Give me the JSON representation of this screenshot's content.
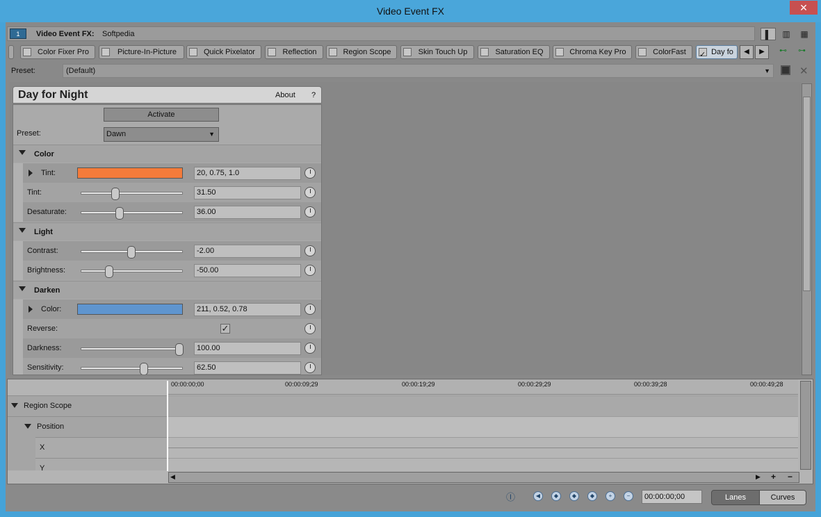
{
  "window": {
    "title": "Video Event FX",
    "close_glyph": "✕"
  },
  "fx_header": {
    "label": "Video Event FX:",
    "name": "Softpedia",
    "badge": "1"
  },
  "tabs": [
    {
      "label": "Color Fixer Pro"
    },
    {
      "label": "Picture-In-Picture"
    },
    {
      "label": "Quick Pixelator"
    },
    {
      "label": "Reflection"
    },
    {
      "label": "Region Scope"
    },
    {
      "label": "Skin Touch Up"
    },
    {
      "label": "Saturation EQ"
    },
    {
      "label": "Chroma Key Pro"
    },
    {
      "label": "ColorFast"
    },
    {
      "label": "Day fo"
    }
  ],
  "preset_bar": {
    "label": "Preset:",
    "value": "(Default)"
  },
  "plugin": {
    "title": "Day for Night",
    "about": "About",
    "help": "?",
    "activate": "Activate",
    "preset_label": "Preset:",
    "preset_value": "Dawn",
    "sections": {
      "color": {
        "title": "Color",
        "tint_color": {
          "label": "Tint:",
          "value": "20, 0.75, 1.0",
          "swatch": "#f47b3a"
        },
        "tint": {
          "label": "Tint:",
          "value": "31.50",
          "pos": 0.315
        },
        "desaturate": {
          "label": "Desaturate:",
          "value": "36.00",
          "pos": 0.36
        }
      },
      "light": {
        "title": "Light",
        "contrast": {
          "label": "Contrast:",
          "value": "-2.00",
          "pos": 0.49
        },
        "brightness": {
          "label": "Brightness:",
          "value": "-50.00",
          "pos": 0.25
        }
      },
      "darken": {
        "title": "Darken",
        "color": {
          "label": "Color:",
          "value": "211, 0.52, 0.78",
          "swatch": "#5f95cf"
        },
        "reverse": {
          "label": "Reverse:",
          "checked": true
        },
        "darkness": {
          "label": "Darkness:",
          "value": "100.00",
          "pos": 1.0
        },
        "sensitivity": {
          "label": "Sensitivity:",
          "value": "62.50",
          "pos": 0.625
        }
      }
    }
  },
  "timeline": {
    "ticks": [
      "00:00:00;00",
      "00:00:09;29",
      "00:00:19;29",
      "00:00:29;29",
      "00:00:39;28",
      "00:00:49;28"
    ],
    "rows": [
      {
        "label": "Region Scope"
      },
      {
        "label": "Position"
      },
      {
        "label": "X"
      },
      {
        "label": "Y"
      }
    ]
  },
  "bottom": {
    "timecode": "00:00:00;00",
    "lanes": "Lanes",
    "curves": "Curves"
  },
  "watermark": "SOFTPEDIA"
}
